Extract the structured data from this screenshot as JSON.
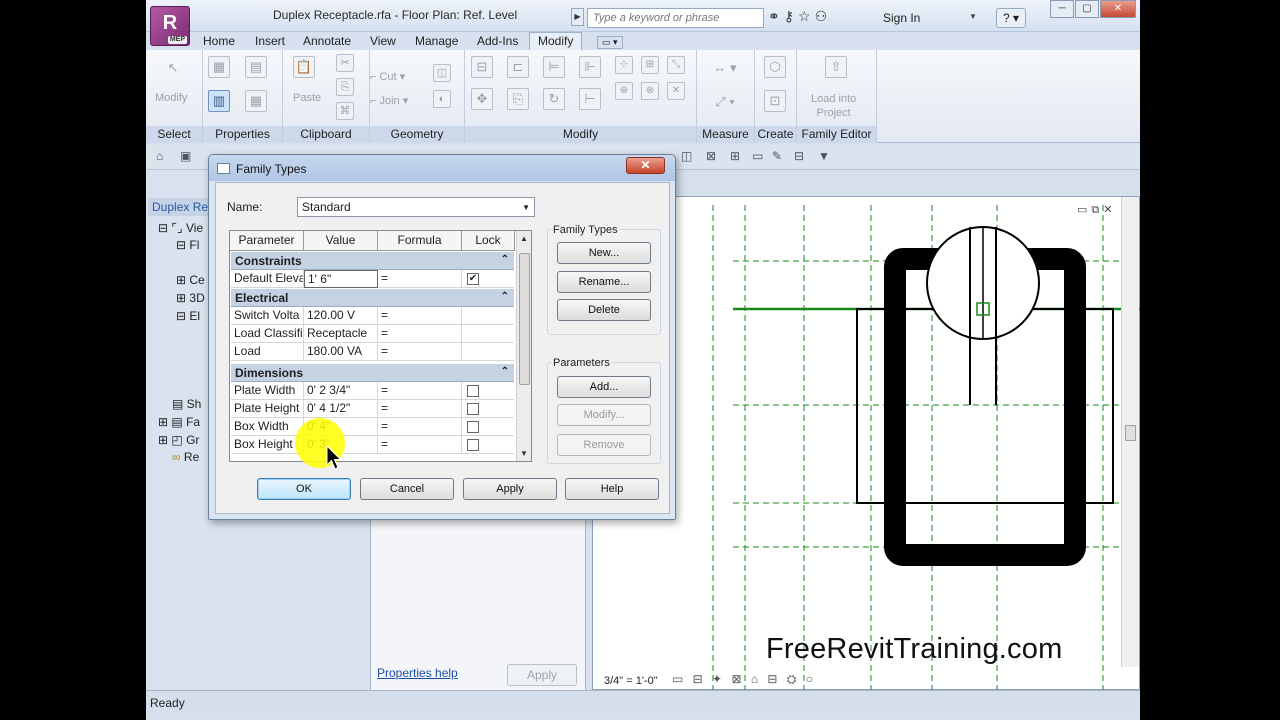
{
  "app": {
    "logo_text": "R",
    "logo_sub": "MEP",
    "title": "Duplex Receptacle.rfa - Floor Plan: Ref. Level",
    "search_placeholder": "Type a keyword or phrase",
    "sign_in": "Sign In",
    "help": "?"
  },
  "menu": {
    "tabs": [
      "Home",
      "Insert",
      "Annotate",
      "View",
      "Manage",
      "Add-Ins",
      "Modify"
    ],
    "active": "Modify"
  },
  "ribbon": {
    "panels": [
      "Select",
      "Properties",
      "Clipboard",
      "Geometry",
      "Modify",
      "Measure",
      "Create",
      "Family Editor"
    ],
    "modify_label": "Modify",
    "paste_label": "Paste",
    "cut_label": "Cut",
    "join_label": "Join",
    "load_into_project": "Load into\nProject"
  },
  "project_browser": {
    "header": "Duplex Rec",
    "items": [
      "Vie",
      "Fl",
      "Ce",
      "3D",
      "El",
      "Sh",
      "Fa",
      "Gr",
      "Re"
    ]
  },
  "properties": {
    "help_link": "Properties help",
    "apply": "Apply"
  },
  "status": {
    "text": "Ready",
    "scale": "3/4\" = 1'-0\""
  },
  "watermark": "FreeRevitTraining.com",
  "dialog": {
    "title": "Family Types",
    "close": "✕",
    "name_label": "Name:",
    "name_value": "Standard",
    "columns": [
      "Parameter",
      "Value",
      "Formula",
      "Lock"
    ],
    "groups": [
      {
        "name": "Constraints",
        "rows": [
          {
            "param": "Default Eleva",
            "value": "1'  6\"",
            "formula": "=",
            "lock": true
          }
        ]
      },
      {
        "name": "Electrical",
        "rows": [
          {
            "param": "Switch Volta",
            "value": "120.00 V",
            "formula": "=",
            "lock": null
          },
          {
            "param": "Load Classifi",
            "value": "Receptacle",
            "formula": "=",
            "lock": null
          },
          {
            "param": "Load",
            "value": "180.00 VA",
            "formula": "=",
            "lock": null
          }
        ]
      },
      {
        "name": "Dimensions",
        "rows": [
          {
            "param": "Plate Width",
            "value": "0'  2 3/4\"",
            "formula": "=",
            "lock": false
          },
          {
            "param": "Plate Height",
            "value": "0'  4 1/2\"",
            "formula": "=",
            "lock": false
          },
          {
            "param": "Box Width",
            "value": "0'  4\"",
            "formula": "=",
            "lock": false
          },
          {
            "param": "Box Height",
            "value": "0'  3\"",
            "formula": "=",
            "lock": false
          }
        ]
      }
    ],
    "family_types_label": "Family Types",
    "family_types_buttons": [
      "New...",
      "Rename...",
      "Delete"
    ],
    "parameters_label": "Parameters",
    "parameters_buttons": [
      "Add...",
      "Modify...",
      "Remove"
    ],
    "footer_buttons": [
      "OK",
      "Cancel",
      "Apply",
      "Help"
    ]
  }
}
